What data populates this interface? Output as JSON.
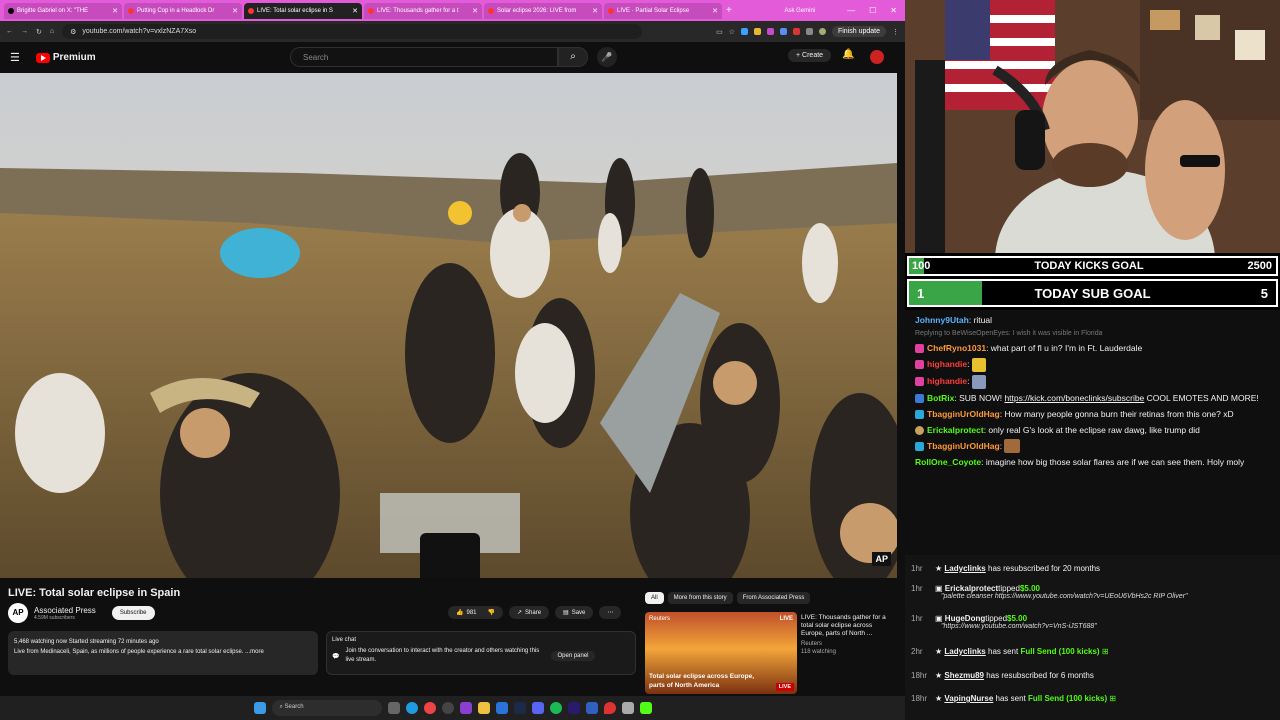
{
  "browser": {
    "tabs": [
      {
        "label": "Brigitte Gabriel on X: \"THE"
      },
      {
        "label": "Putting Cop in a Headlock Dr"
      },
      {
        "label": "LIVE: Total solar eclipse in S"
      },
      {
        "label": "LIVE: Thousands gather for a t"
      },
      {
        "label": "Solar eclipse 2026: LIVE from"
      },
      {
        "label": "LIVE · Partial Solar Eclipse"
      }
    ],
    "ask_gemini": "Ask Gemini",
    "url": "youtube.com/watch?v=vxlzNZA7Xso",
    "finish_update": "Finish update"
  },
  "youtube": {
    "premium_label": "Premium",
    "search_placeholder": "Search",
    "create_label": "Create",
    "video_title": "LIVE: Total solar eclipse in Spain",
    "channel_name": "Associated Press",
    "channel_initials": "AP",
    "subscribers": "4.59M subscribers",
    "subscribe_label": "Subscribe",
    "likes": "981",
    "share_label": "Share",
    "save_label": "Save",
    "description": {
      "stats": "5,468 watching now  Started streaming 72 minutes ago",
      "text": "Live from Medinaceli, Spain, as millions of people experience a rare total solar eclipse.",
      "more": "...more"
    },
    "live_chat": {
      "title": "Live chat",
      "text": "Join the conversation to interact with the creator and others watching this live stream.",
      "button": "Open panel"
    },
    "chips": [
      "All",
      "More from this story",
      "From Associated Press"
    ],
    "recommended": {
      "thumb_source": "Reuters",
      "thumb_live": "LIVE",
      "thumb_caption": "Total solar eclipse across Europe, parts of North America",
      "thumb_badge": "LIVE",
      "title": "LIVE: Thousands gather for a total solar eclipse across Europe, parts of North ...",
      "channel": "Reuters",
      "watching": "118 watching"
    },
    "ap_watermark": "AP"
  },
  "taskbar": {
    "search": "Search"
  },
  "overlay": {
    "kicks_goal": {
      "label": "TODAY KICKS GOAL",
      "current": "100",
      "target": "2500",
      "fraction": 0.04
    },
    "sub_goal": {
      "label": "TODAY SUB GOAL",
      "current": "1",
      "target": "5",
      "fraction": 0.2
    },
    "chat": [
      {
        "user": "Johnny9Utah",
        "text": ": ritual",
        "color": "#5ab2ff"
      },
      {
        "reply": "Replying to BeWiseOpenEyes: I wish it was visible in Florida"
      },
      {
        "user": "ChefRyno1031",
        "text": ": what part of fl u in? I'm in Ft. Lauderdale",
        "color": "#ff9a3c"
      },
      {
        "user": "highandie",
        "text": ":",
        "color": "#ff3b3b"
      },
      {
        "user": "highandie",
        "text": ":",
        "color": "#ff3b3b"
      },
      {
        "user": "BotRix",
        "text": ": SUB NOW! ",
        "link": "https://kick.com/boneclinks/subscribe",
        "after": " COOL EMOTES AND MORE!",
        "color": "#53fc18"
      },
      {
        "user": "TbagginUrOldHag",
        "text": ": How many people gonna burn their retinas from this one? xD",
        "color": "#ff9a3c"
      },
      {
        "user": "Erickalprotect",
        "text": ": only real G's look at the eclipse raw dawg, like trump did",
        "color": "#53fc18"
      },
      {
        "user": "TbagginUrOldHag",
        "text": ":",
        "color": "#ff9a3c"
      },
      {
        "user": "RollOne_Coyote",
        "text": ": imagine how big those solar flares are if we can see them. Holy moly",
        "color": "#53fc18"
      }
    ],
    "events": [
      {
        "time": "1hr",
        "name": "Ladyclinks",
        "text": " has resubscribed for 20 months"
      },
      {
        "time": "1hr",
        "name": "Erickalprotect",
        "text": "tipped",
        "amount": "$5.00",
        "note": "\"palette cleanser https://www.youtube.com/watch?v=UEoU6VbHs2c RIP Oliver\""
      },
      {
        "time": "1hr",
        "name": "HugeDong",
        "text": "tipped",
        "amount": "$5.00",
        "note": "\"https://www.youtube.com/watch?v=VnS-iJST688\""
      },
      {
        "time": "2hr",
        "name": "Ladyclinks",
        "text": " has sent ",
        "green": "Full Send (100 kicks)"
      },
      {
        "time": "18hr",
        "name": "Shezmu89",
        "text": " has resubscribed for 6 months"
      },
      {
        "time": "18hr",
        "name": "VapingNurse",
        "text": " has sent ",
        "green": "Full Send (100 kicks)"
      }
    ]
  },
  "colors": {
    "kick_green": "#53fc18",
    "goal_fill": "#3aa547",
    "tab_pink": "#e35bd8"
  }
}
